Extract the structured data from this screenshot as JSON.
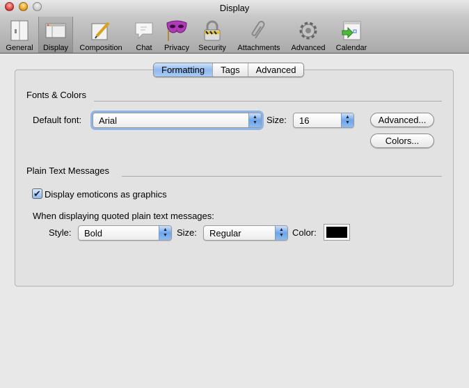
{
  "window": {
    "title": "Display",
    "colors": {
      "close": "#e0443e",
      "minimize": "#e6a21e",
      "zoom": "#b8b8b8"
    }
  },
  "toolbar": [
    {
      "label": "General",
      "icon": "general-icon"
    },
    {
      "label": "Display",
      "icon": "display-icon",
      "selected": true
    },
    {
      "label": "Composition",
      "icon": "composition-icon"
    },
    {
      "label": "Chat",
      "icon": "chat-icon"
    },
    {
      "label": "Privacy",
      "icon": "privacy-icon"
    },
    {
      "label": "Security",
      "icon": "security-icon"
    },
    {
      "label": "Attachments",
      "icon": "attachments-icon"
    },
    {
      "label": "Advanced",
      "icon": "advanced-icon"
    },
    {
      "label": "Calendar",
      "icon": "calendar-icon"
    }
  ],
  "tabs": [
    {
      "label": "Formatting",
      "active": true
    },
    {
      "label": "Tags"
    },
    {
      "label": "Advanced"
    }
  ],
  "fonts": {
    "section": "Fonts & Colors",
    "default_font_label": "Default font:",
    "default_font": "Arial",
    "size_label": "Size:",
    "size": "16",
    "advanced_button": "Advanced...",
    "colors_button": "Colors..."
  },
  "plain": {
    "section": "Plain Text Messages",
    "emoticons_label": "Display emoticons as graphics",
    "emoticons_checked": true,
    "quoted_label": "When displaying quoted plain text messages:",
    "style_label": "Style:",
    "style": "Bold",
    "size_label": "Size:",
    "size": "Regular",
    "color_label": "Color:",
    "color": "#000000"
  }
}
